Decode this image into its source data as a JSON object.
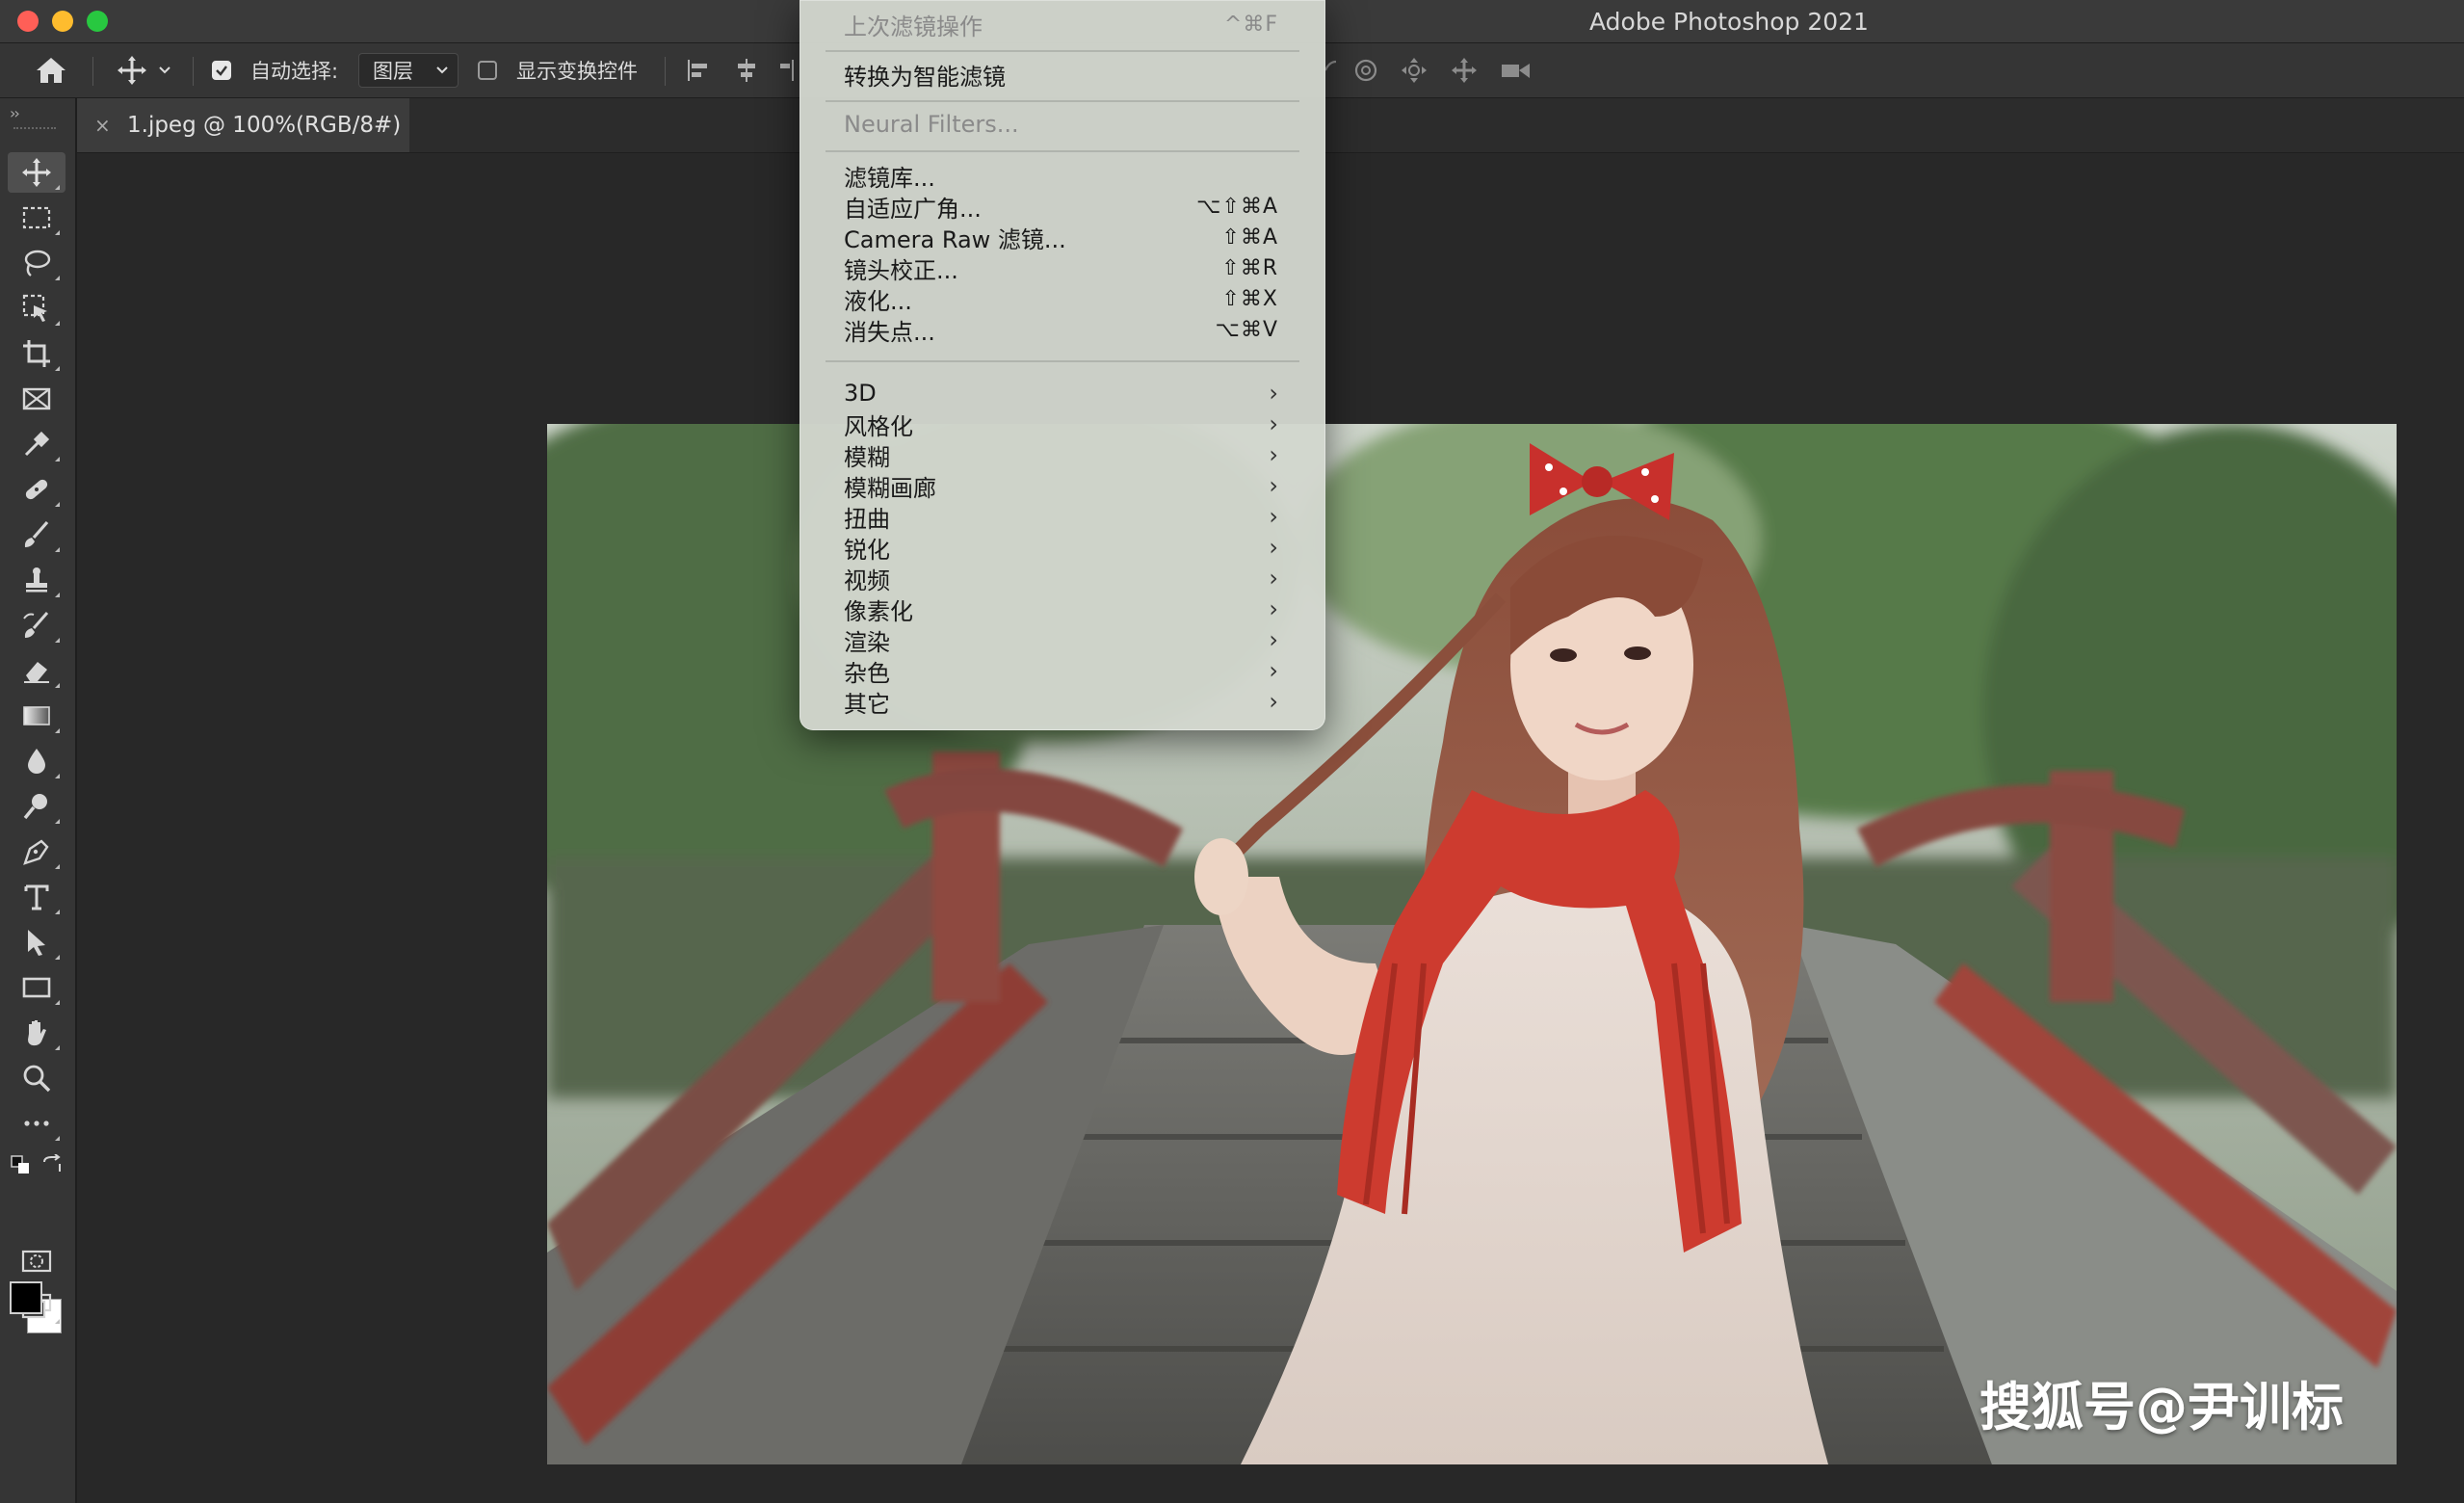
{
  "window": {
    "title": "Adobe Photoshop 2021"
  },
  "options_bar": {
    "auto_select_label": "自动选择:",
    "auto_select_checked": true,
    "auto_select_target": "图层",
    "show_transform_label": "显示变换控件",
    "show_transform_checked": false
  },
  "document_tab": {
    "close_glyph": "×",
    "title": "1.jpeg @ 100%(RGB/8#)"
  },
  "filter_menu": {
    "last_filter": {
      "label": "上次滤镜操作",
      "shortcut": "^⌘F",
      "enabled": false
    },
    "convert_smart": {
      "label": "转换为智能滤镜"
    },
    "neural_filters": {
      "label": "Neural Filters...",
      "enabled": false
    },
    "items": [
      {
        "label": "滤镜库...",
        "shortcut": ""
      },
      {
        "label": "自适应广角...",
        "shortcut": "⌥⇧⌘A"
      },
      {
        "label": "Camera Raw 滤镜...",
        "shortcut": "⇧⌘A"
      },
      {
        "label": "镜头校正...",
        "shortcut": "⇧⌘R"
      },
      {
        "label": "液化...",
        "shortcut": "⇧⌘X"
      },
      {
        "label": "消失点...",
        "shortcut": "⌥⌘V"
      }
    ],
    "submenus": [
      "3D",
      "风格化",
      "模糊",
      "模糊画廊",
      "扭曲",
      "锐化",
      "视频",
      "像素化",
      "渲染",
      "杂色",
      "其它"
    ],
    "submenu_arrow": "›"
  },
  "toolbar": {
    "tools": [
      "move-tool",
      "marquee-tool",
      "lasso-tool",
      "object-select-tool",
      "crop-tool",
      "frame-tool",
      "eyedropper-tool",
      "healing-brush-tool",
      "brush-tool",
      "clone-stamp-tool",
      "history-brush-tool",
      "eraser-tool",
      "gradient-tool",
      "blur-tool",
      "dodge-tool",
      "pen-tool",
      "type-tool",
      "path-selection-tool",
      "rectangle-tool",
      "hand-tool",
      "zoom-tool",
      "more-tools"
    ],
    "foreground_color": "#000000",
    "background_color": "#ffffff"
  },
  "canvas": {
    "watermark": "搜狐号@尹训标"
  }
}
